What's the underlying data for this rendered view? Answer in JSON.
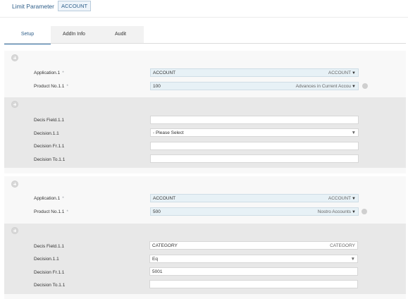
{
  "header": {
    "title": "Limit Parameter",
    "record_id": "ACCOUNT"
  },
  "tabs": [
    {
      "label": "Setup",
      "active": true
    },
    {
      "label": "AddIn Info",
      "active": false
    },
    {
      "label": "Audit",
      "active": false
    }
  ],
  "groups": [
    {
      "application_label": "Application.1",
      "application_value": "ACCOUNT",
      "application_desc": "ACCOUNT",
      "product_label": "Product No.1.1",
      "product_value": "100",
      "product_desc": "Advances in Current Accou",
      "decision_block": {
        "field_label": "Decis Field.1.1",
        "field_value": "",
        "field_desc": "",
        "decision_label": "Decision.1.1",
        "decision_value": "- Please Select",
        "from_label": "Decision Fr.1.1",
        "from_value": "",
        "to_label": "Decision To.1.1",
        "to_value": ""
      }
    },
    {
      "application_label": "Application.1",
      "application_value": "ACCOUNT",
      "application_desc": "ACCOUNT",
      "product_label": "Product No.1.1",
      "product_value": "500",
      "product_desc": "Nostro Accounts",
      "decision_block": {
        "field_label": "Decis Field.1.1",
        "field_value": "CATEGORY",
        "field_desc": "CATEGORY",
        "decision_label": "Decision.1.1",
        "decision_value": "Eq",
        "from_label": "Decision Fr.1.1",
        "from_value": "5001",
        "to_label": "Decision To.1.1",
        "to_value": ""
      }
    }
  ],
  "required_marker": "*",
  "dropdown_arrow": "▼"
}
